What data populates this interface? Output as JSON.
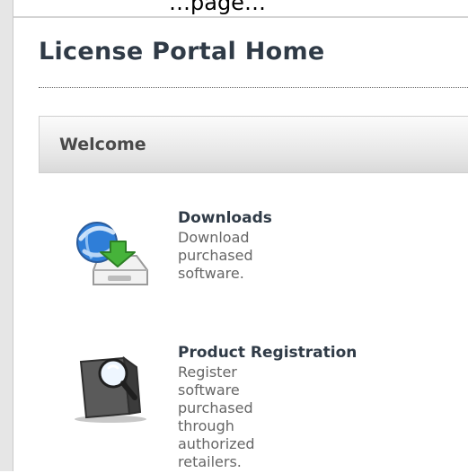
{
  "header": {
    "top_text": "…page…"
  },
  "page": {
    "title": "License Portal Home"
  },
  "welcome": {
    "title": "Welcome"
  },
  "items": [
    {
      "title": "Downloads",
      "description_lines": [
        "Download purchased",
        "software."
      ],
      "icon": "downloads-icon"
    },
    {
      "title": "Product Registration",
      "description_lines": [
        "Register software",
        "purchased through",
        "authorized retailers."
      ],
      "icon": "product-registration-icon"
    }
  ]
}
